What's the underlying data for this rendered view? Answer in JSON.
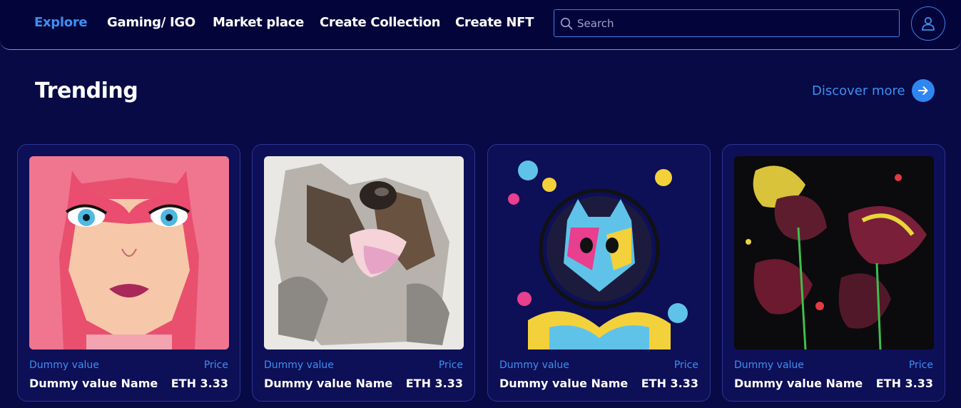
{
  "nav": {
    "links": [
      {
        "label": "Explore",
        "active": true
      },
      {
        "label": "Gaming/ IGO",
        "active": false
      },
      {
        "label": "Market place",
        "active": false
      },
      {
        "label": "Create Collection",
        "active": false
      },
      {
        "label": "Create NFT",
        "active": false
      }
    ],
    "search": {
      "placeholder": "Search",
      "value": ""
    },
    "avatar_icon": "user-icon"
  },
  "trending": {
    "title": "Trending",
    "discover_label": "Discover more",
    "discover_icon": "arrow-right-icon",
    "cards": [
      {
        "image": "pink-hair-girl-artwork",
        "subtitle": "Dummy value",
        "price_label": "Price",
        "name": "Dummy value Name",
        "price": "ETH 3.33"
      },
      {
        "image": "sketched-dog-artwork",
        "subtitle": "Dummy value",
        "price_label": "Price",
        "name": "Dummy value Name",
        "price": "ETH 3.33"
      },
      {
        "image": "splatter-astronaut-cat-artwork",
        "subtitle": "Dummy value",
        "price_label": "Price",
        "name": "Dummy value Name",
        "price": "ETH 3.33"
      },
      {
        "image": "neon-flowers-artwork",
        "subtitle": "Dummy value",
        "price_label": "Price",
        "name": "Dummy value Name",
        "price": "ETH 3.33"
      }
    ]
  },
  "colors": {
    "background": "#070a45",
    "navbar": "#03053a",
    "accent": "#3d8ff2",
    "card": "#0d0f57",
    "card_border": "#2f3491"
  }
}
